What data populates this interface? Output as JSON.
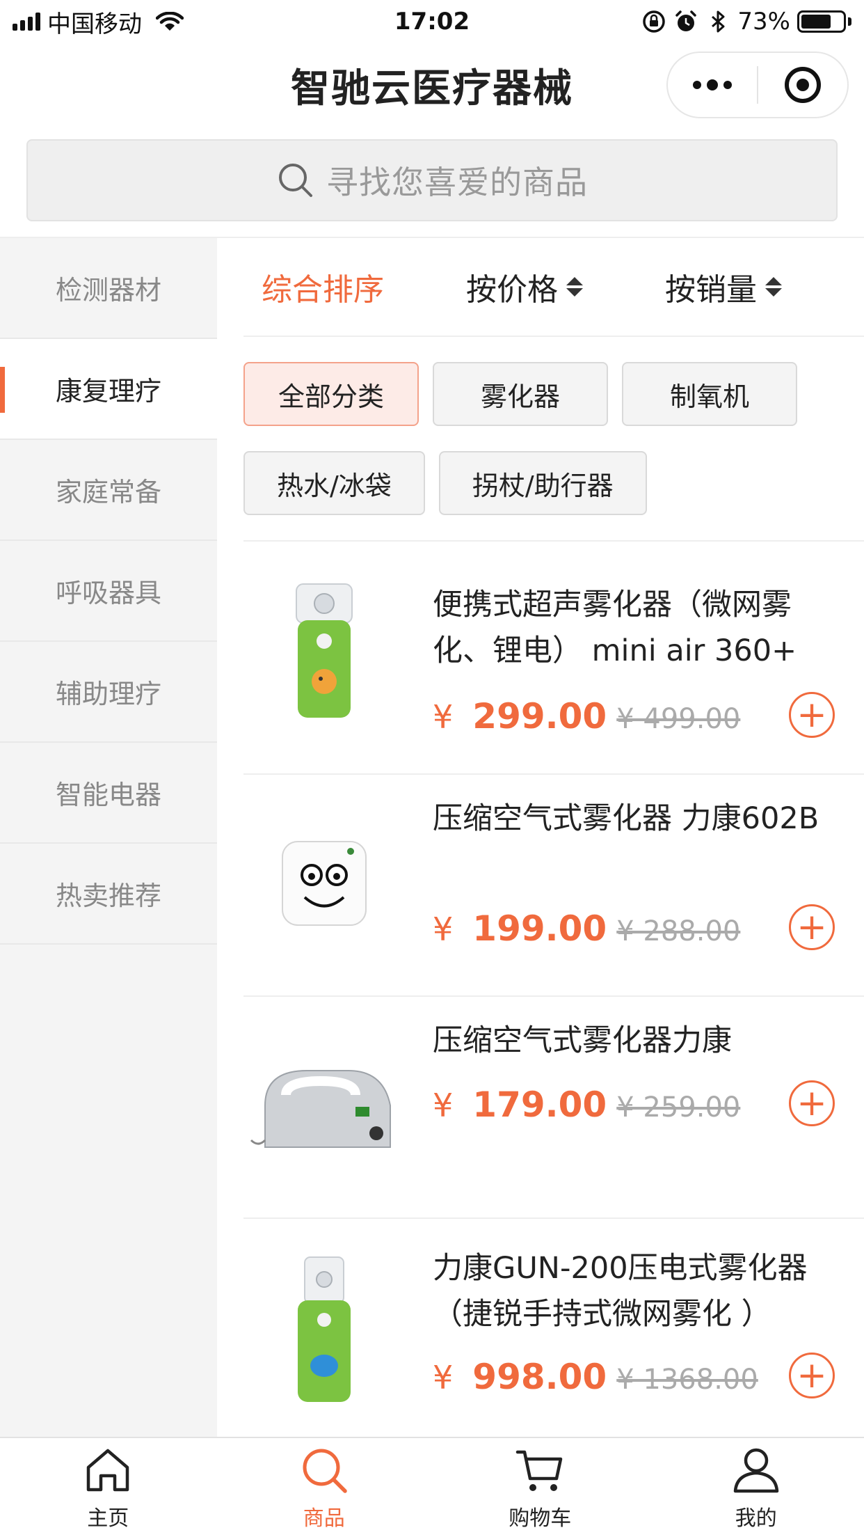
{
  "status_bar": {
    "carrier": "中国移动",
    "time": "17:02",
    "battery_text": "73%",
    "battery_level": 0.73
  },
  "header": {
    "title": "智驰云医疗器械"
  },
  "search": {
    "placeholder": "寻找您喜爱的商品"
  },
  "sidebar": {
    "items": [
      {
        "label": "检测器材"
      },
      {
        "label": "康复理疗",
        "active": true
      },
      {
        "label": "家庭常备"
      },
      {
        "label": "呼吸器具"
      },
      {
        "label": "辅助理疗"
      },
      {
        "label": "智能电器"
      },
      {
        "label": "热卖推荐"
      }
    ]
  },
  "sort": {
    "items": [
      {
        "label": "综合排序",
        "active": true
      },
      {
        "label": "按价格"
      },
      {
        "label": "按销量"
      }
    ]
  },
  "chips": [
    {
      "label": "全部分类",
      "active": true
    },
    {
      "label": "雾化器"
    },
    {
      "label": "制氧机"
    },
    {
      "label": "热水/冰袋"
    },
    {
      "label": "拐杖/助行器"
    }
  ],
  "products": [
    {
      "name": "便携式超声雾化器（微网雾化、锂电） mini air 360+",
      "currency": "¥",
      "price": "299.00",
      "original_price": "¥ 499.00"
    },
    {
      "name": "压缩空气式雾化器 力康602B",
      "currency": "¥",
      "price": "199.00",
      "original_price": "¥ 288.00"
    },
    {
      "name": "压缩空气式雾化器力康",
      "currency": "¥",
      "price": "179.00",
      "original_price": "¥ 259.00"
    },
    {
      "name": "力康GUN-200压电式雾化器（捷锐手持式微网雾化 ）",
      "currency": "¥",
      "price": "998.00",
      "original_price": "¥ 1368.00"
    }
  ],
  "tabbar": {
    "items": [
      {
        "label": "主页",
        "icon": "home-icon"
      },
      {
        "label": "商品",
        "icon": "search-icon",
        "active": true
      },
      {
        "label": "购物车",
        "icon": "cart-icon"
      },
      {
        "label": "我的",
        "icon": "user-icon"
      }
    ]
  },
  "colors": {
    "accent": "#f06a3d"
  }
}
